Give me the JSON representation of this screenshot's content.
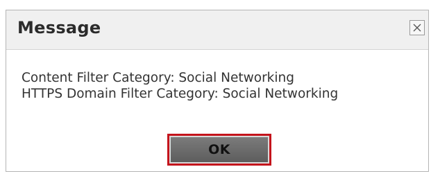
{
  "dialog": {
    "title": "Message",
    "close_icon": "close-icon",
    "message_lines": [
      "Content Filter Category: Social Networking",
      "HTTPS Domain Filter Category: Social Networking"
    ],
    "ok_label": "OK"
  },
  "colors": {
    "title_bar_bg": "#f0f0f0",
    "ok_button_bg": "#6b6b6b",
    "ok_button_focus_border": "#c4141c"
  }
}
